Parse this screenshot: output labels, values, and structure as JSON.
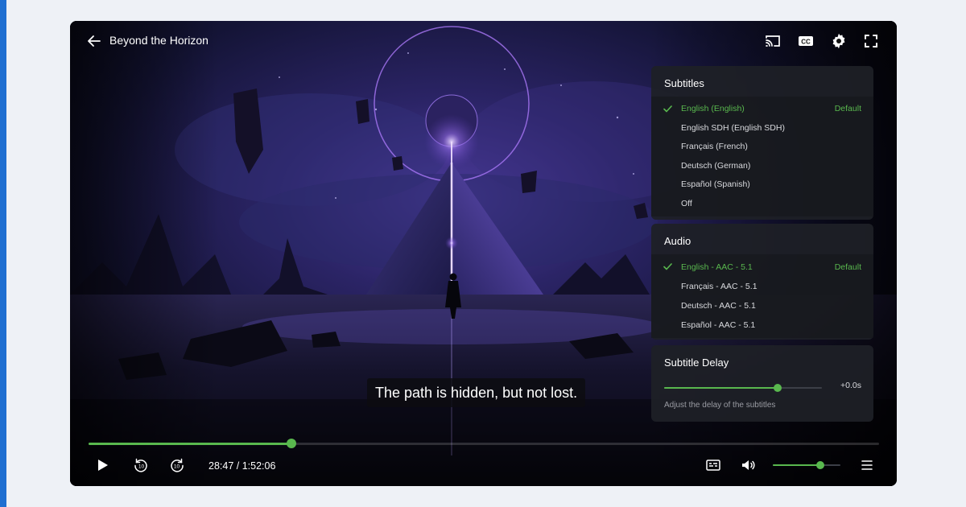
{
  "colors": {
    "accent": "#59b84e",
    "brand_strip": "#1f6fd1",
    "panel_bg": "#1e2026"
  },
  "header": {
    "title": "Beyond the Horizon",
    "back_icon": "arrow-left-icon",
    "icons": [
      "cast-icon",
      "closed-captions-icon",
      "gear-icon",
      "fullscreen-icon"
    ]
  },
  "subtitles": {
    "heading": "Subtitles",
    "default_label": "Default",
    "options": [
      {
        "label": "English (English)",
        "selected": true
      },
      {
        "label": "English SDH (English SDH)",
        "selected": false
      },
      {
        "label": "Français (French)",
        "selected": false
      },
      {
        "label": "Deutsch (German)",
        "selected": false
      },
      {
        "label": "Español (Spanish)",
        "selected": false
      },
      {
        "label": "Off",
        "selected": false
      }
    ]
  },
  "audio": {
    "heading": "Audio",
    "default_label": "Default",
    "options": [
      {
        "label": "English - AAC - 5.1",
        "selected": true
      },
      {
        "label": "Français - AAC - 5.1",
        "selected": false
      },
      {
        "label": "Deutsch - AAC - 5.1",
        "selected": false
      },
      {
        "label": "Español - AAC - 5.1",
        "selected": false
      }
    ]
  },
  "subtitle_delay": {
    "heading": "Subtitle Delay",
    "value": "+0.0s",
    "level": 0.72,
    "help": "Adjust the delay of the subtitles"
  },
  "caption": {
    "text": "The path is hidden, but not lost."
  },
  "playback": {
    "time_display": "28:47 / 1:52:06",
    "progress": 0.2568,
    "volume": 0.7,
    "controls": [
      "play-icon",
      "rewind-10-icon",
      "forward-10-icon",
      "subtitles-track-icon",
      "volume-icon",
      "menu-icon"
    ]
  }
}
